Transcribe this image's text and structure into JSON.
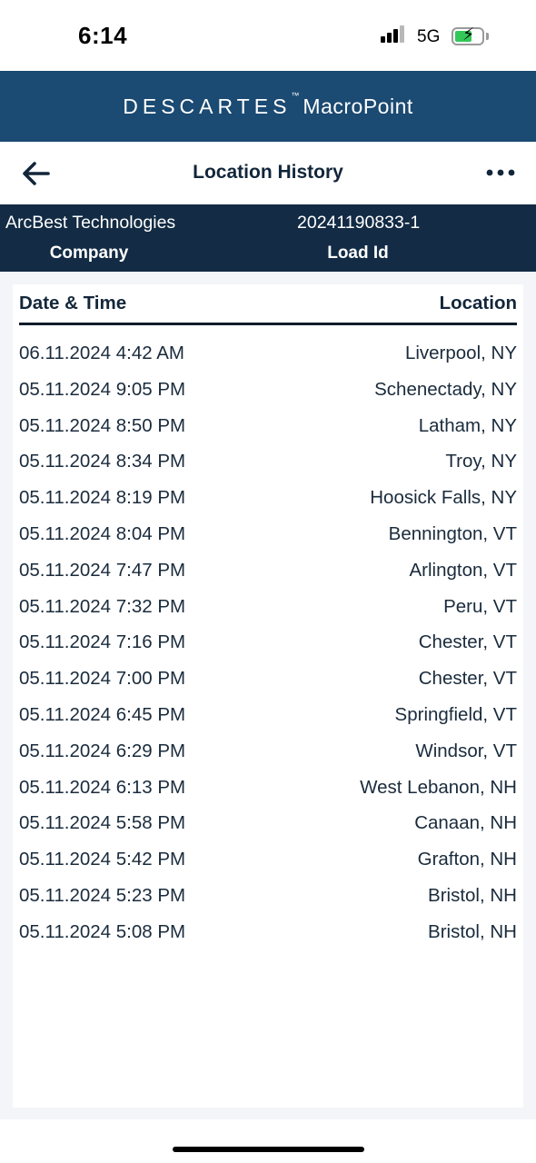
{
  "status_bar": {
    "time": "6:14",
    "network": "5G",
    "battery_charging": true,
    "battery_color": "#34c759"
  },
  "brand": {
    "name": "DESCARTES",
    "trademark": "™",
    "product": "MacroPoint",
    "background": "#1b4a72"
  },
  "header": {
    "title": "Location History",
    "back_icon": "arrow-left-icon",
    "more_icon": "more-horizontal-icon"
  },
  "info": {
    "company_value": "ArcBest Technologies",
    "company_label": "Company",
    "load_value": "20241190833-1",
    "load_label": "Load Id",
    "background": "#132b44"
  },
  "table": {
    "columns": [
      "Date & Time",
      "Location"
    ],
    "rows": [
      {
        "datetime": "06.11.2024 4:42 AM",
        "location": "Liverpool, NY"
      },
      {
        "datetime": "05.11.2024 9:05 PM",
        "location": "Schenectady, NY"
      },
      {
        "datetime": "05.11.2024 8:50 PM",
        "location": "Latham, NY"
      },
      {
        "datetime": "05.11.2024 8:34 PM",
        "location": "Troy, NY"
      },
      {
        "datetime": "05.11.2024 8:19 PM",
        "location": "Hoosick Falls, NY"
      },
      {
        "datetime": "05.11.2024 8:04 PM",
        "location": "Bennington, VT"
      },
      {
        "datetime": "05.11.2024 7:47 PM",
        "location": "Arlington, VT"
      },
      {
        "datetime": "05.11.2024 7:32 PM",
        "location": "Peru, VT"
      },
      {
        "datetime": "05.11.2024 7:16 PM",
        "location": "Chester, VT"
      },
      {
        "datetime": "05.11.2024 7:00 PM",
        "location": "Chester, VT"
      },
      {
        "datetime": "05.11.2024 6:45 PM",
        "location": "Springfield, VT"
      },
      {
        "datetime": "05.11.2024 6:29 PM",
        "location": "Windsor, VT"
      },
      {
        "datetime": "05.11.2024 6:13 PM",
        "location": "West Lebanon, NH"
      },
      {
        "datetime": "05.11.2024 5:58 PM",
        "location": "Canaan, NH"
      },
      {
        "datetime": "05.11.2024 5:42 PM",
        "location": "Grafton, NH"
      },
      {
        "datetime": "05.11.2024 5:23 PM",
        "location": "Bristol, NH"
      },
      {
        "datetime": "05.11.2024 5:08 PM",
        "location": "Bristol, NH"
      }
    ]
  }
}
